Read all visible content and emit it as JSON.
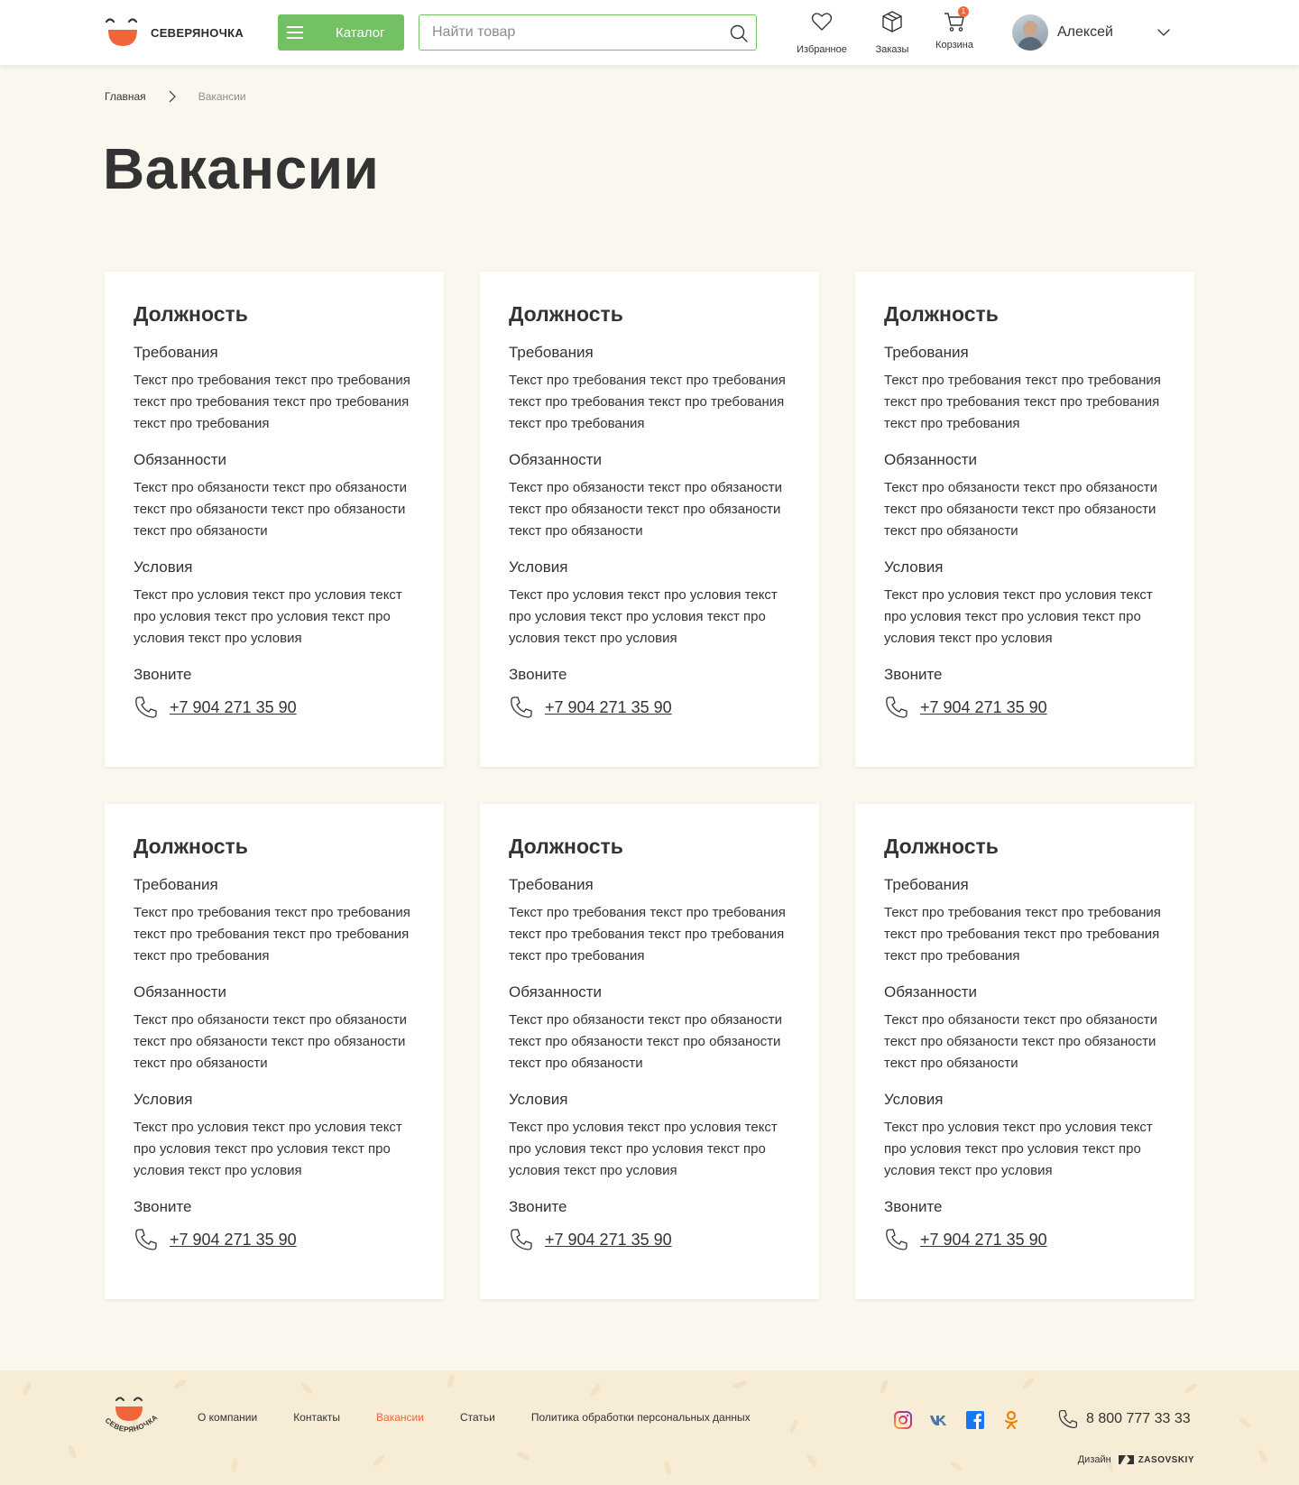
{
  "header": {
    "logo_text": "СЕВЕРЯНОЧКА",
    "catalog_label": "Каталог",
    "search_placeholder": "Найти товар",
    "favorites_label": "Избранное",
    "orders_label": "Заказы",
    "cart_label": "Корзина",
    "cart_count": "1",
    "user_name": "Алексей"
  },
  "breadcrumb": {
    "home": "Главная",
    "current": "Вакансии"
  },
  "page_title": "Вакансии",
  "vacancies": [
    {
      "position": "Должность",
      "req_title": "Требования",
      "req_text": "Текст про требования текст про требования текст про требования текст про требования текст про требования",
      "duty_title": "Обязанности",
      "duty_text": "Текст про обязаности текст про обязаности текст про обязаности текст про обязаности текст про обязаности",
      "cond_title": "Условия",
      "cond_text": "Текст про условия текст про условия текст про условия текст про условия текст про условия текст про условия",
      "call_title": "Звоните",
      "phone": "+7 904 271 35 90"
    },
    {
      "position": "Должность",
      "req_title": "Требования",
      "req_text": "Текст про требования текст про требования текст про требования текст про требования текст про требования",
      "duty_title": "Обязанности",
      "duty_text": "Текст про обязаности текст про обязаности текст про обязаности текст про обязаности текст про обязаности",
      "cond_title": "Условия",
      "cond_text": "Текст про условия текст про условия текст про условия текст про условия текст про условия текст про условия",
      "call_title": "Звоните",
      "phone": "+7 904 271 35 90"
    },
    {
      "position": "Должность",
      "req_title": "Требования",
      "req_text": "Текст про требования текст про требования текст про требования текст про требования текст про требования",
      "duty_title": "Обязанности",
      "duty_text": "Текст про обязаности текст про обязаности текст про обязаности текст про обязаности текст про обязаности",
      "cond_title": "Условия",
      "cond_text": "Текст про условия текст про условия текст про условия текст про условия текст про условия текст про условия",
      "call_title": "Звоните",
      "phone": "+7 904 271 35 90"
    },
    {
      "position": "Должность",
      "req_title": "Требования",
      "req_text": "Текст про требования текст про требования текст про требования текст про требования текст про требования",
      "duty_title": "Обязанности",
      "duty_text": "Текст про обязаности текст про обязаности текст про обязаности текст про обязаности текст про обязаности",
      "cond_title": "Условия",
      "cond_text": "Текст про условия текст про условия текст про условия текст про условия текст про условия текст про условия",
      "call_title": "Звоните",
      "phone": "+7 904 271 35 90"
    },
    {
      "position": "Должность",
      "req_title": "Требования",
      "req_text": "Текст про требования текст про требования текст про требования текст про требования текст про требования",
      "duty_title": "Обязанности",
      "duty_text": "Текст про обязаности текст про обязаности текст про обязаности текст про обязаности текст про обязаности",
      "cond_title": "Условия",
      "cond_text": "Текст про условия текст про условия текст про условия текст про условия текст про условия текст про условия",
      "call_title": "Звоните",
      "phone": "+7 904 271 35 90"
    },
    {
      "position": "Должность",
      "req_title": "Требования",
      "req_text": "Текст про требования текст про требования текст про требования текст про требования текст про требования",
      "duty_title": "Обязанности",
      "duty_text": "Текст про обязаности текст про обязаности текст про обязаности текст про обязаности текст про обязаности",
      "cond_title": "Условия",
      "cond_text": "Текст про условия текст про условия текст про условия текст про условия текст про условия текст про условия",
      "call_title": "Звоните",
      "phone": "+7 904 271 35 90"
    }
  ],
  "footer": {
    "nav": [
      "О компании",
      "Контакты",
      "Вакансии",
      "Статьи",
      "Политика обработки персональных данных"
    ],
    "active_nav": "Вакансии",
    "socials": [
      "instagram-icon",
      "vk-icon",
      "facebook-icon",
      "odnoklassniki-icon"
    ],
    "phone": "8 800 777 33 33",
    "design_label": "Дизайн",
    "design_brand": "ZASOVSKIY"
  },
  "colors": {
    "accent_green": "#74c065",
    "accent_orange": "#f0663a",
    "page_bg": "#f9f7ee",
    "footer_bg": "#f7ecd6"
  }
}
